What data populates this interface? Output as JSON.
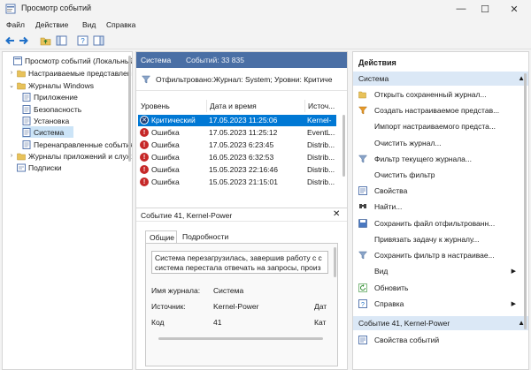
{
  "window": {
    "title": "Просмотр событий",
    "minimize": "—",
    "maximize": "☐",
    "close": "✕"
  },
  "menu": [
    "Файл",
    "Действие",
    "Вид",
    "Справка"
  ],
  "tree": {
    "items": [
      {
        "label": "Просмотр событий (Локальный)",
        "level": 0,
        "twisty": ""
      },
      {
        "label": "Настраиваемые представления",
        "level": 1,
        "twisty": "›"
      },
      {
        "label": "Журналы Windows",
        "level": 1,
        "twisty": "⌄"
      },
      {
        "label": "Приложение",
        "level": 2,
        "twisty": ""
      },
      {
        "label": "Безопасность",
        "level": 2,
        "twisty": ""
      },
      {
        "label": "Установка",
        "level": 2,
        "twisty": ""
      },
      {
        "label": "Система",
        "level": 2,
        "twisty": "",
        "selected": true
      },
      {
        "label": "Перенаправленные события",
        "level": 2,
        "twisty": ""
      },
      {
        "label": "Журналы приложений и служб",
        "level": 1,
        "twisty": "›"
      },
      {
        "label": "Подписки",
        "level": 1,
        "twisty": ""
      }
    ]
  },
  "log": {
    "name": "Система",
    "count_label": "Событий: 33 835",
    "filter_text": "Отфильтровано:Журнал: System; Уровни: Критиче",
    "columns": [
      "Уровень",
      "Дата и время",
      "Источ..."
    ],
    "rows": [
      {
        "level": "Критический",
        "kind": "crit",
        "datetime": "17.05.2023 11:25:06",
        "source": "Kernel-",
        "selected": true
      },
      {
        "level": "Ошибка",
        "kind": "err",
        "datetime": "17.05.2023 11:25:12",
        "source": "EventL..."
      },
      {
        "level": "Ошибка",
        "kind": "err",
        "datetime": "17.05.2023 6:23:45",
        "source": "Distrib..."
      },
      {
        "level": "Ошибка",
        "kind": "err",
        "datetime": "16.05.2023 6:32:53",
        "source": "Distrib..."
      },
      {
        "level": "Ошибка",
        "kind": "err",
        "datetime": "15.05.2023 22:16:46",
        "source": "Distrib..."
      },
      {
        "level": "Ошибка",
        "kind": "err",
        "datetime": "15.05.2023 21:15:01",
        "source": "Distrib..."
      }
    ]
  },
  "detail": {
    "title": "Событие 41, Kernel-Power",
    "tabs": [
      "Общие",
      "Подробности"
    ],
    "message_line1": "Система перезагрузилась, завершив работу с с",
    "message_line2": "система перестала отвечать на запросы, произ",
    "fields": [
      {
        "label": "Имя журнала:",
        "value": "Система",
        "extra": ""
      },
      {
        "label": "Источник:",
        "value": "Kernel-Power",
        "extra": "Дат"
      },
      {
        "label": "Код",
        "value": "41",
        "extra": "Кат"
      }
    ]
  },
  "actions": {
    "title": "Действия",
    "section1": "Система",
    "items1": [
      {
        "label": "Открыть сохраненный журнал...",
        "icon": "open-log",
        "sub": false
      },
      {
        "label": "Создать настраиваемое представ...",
        "icon": "filter-create",
        "sub": false
      },
      {
        "label": "Импорт настраиваемого предста...",
        "icon": "",
        "sub": false
      },
      {
        "label": "Очистить журнал...",
        "icon": "",
        "sub": false
      },
      {
        "label": "Фильтр текущего журнала...",
        "icon": "filter",
        "sub": false
      },
      {
        "label": "Очистить фильтр",
        "icon": "",
        "sub": false
      },
      {
        "label": "Свойства",
        "icon": "properties",
        "sub": false
      },
      {
        "label": "Найти...",
        "icon": "find",
        "sub": false
      },
      {
        "label": "Сохранить файл отфильтрованн...",
        "icon": "save",
        "sub": false
      },
      {
        "label": "Привязать задачу к журналу...",
        "icon": "",
        "sub": false
      },
      {
        "label": "Сохранить фильтр в настраивае...",
        "icon": "save-filter",
        "sub": false
      },
      {
        "label": "Вид",
        "icon": "",
        "sub": true
      },
      {
        "label": "Обновить",
        "icon": "refresh",
        "sub": false
      },
      {
        "label": "Справка",
        "icon": "help",
        "sub": true
      }
    ],
    "section2": "Событие 41, Kernel-Power",
    "items2": [
      {
        "label": "Свойства событий",
        "icon": "properties",
        "sub": false
      }
    ]
  },
  "colors": {
    "accent": "#0078d4",
    "section": "#dbe8f6",
    "error": "#c62828",
    "mid_header": "#4a6fa5"
  }
}
